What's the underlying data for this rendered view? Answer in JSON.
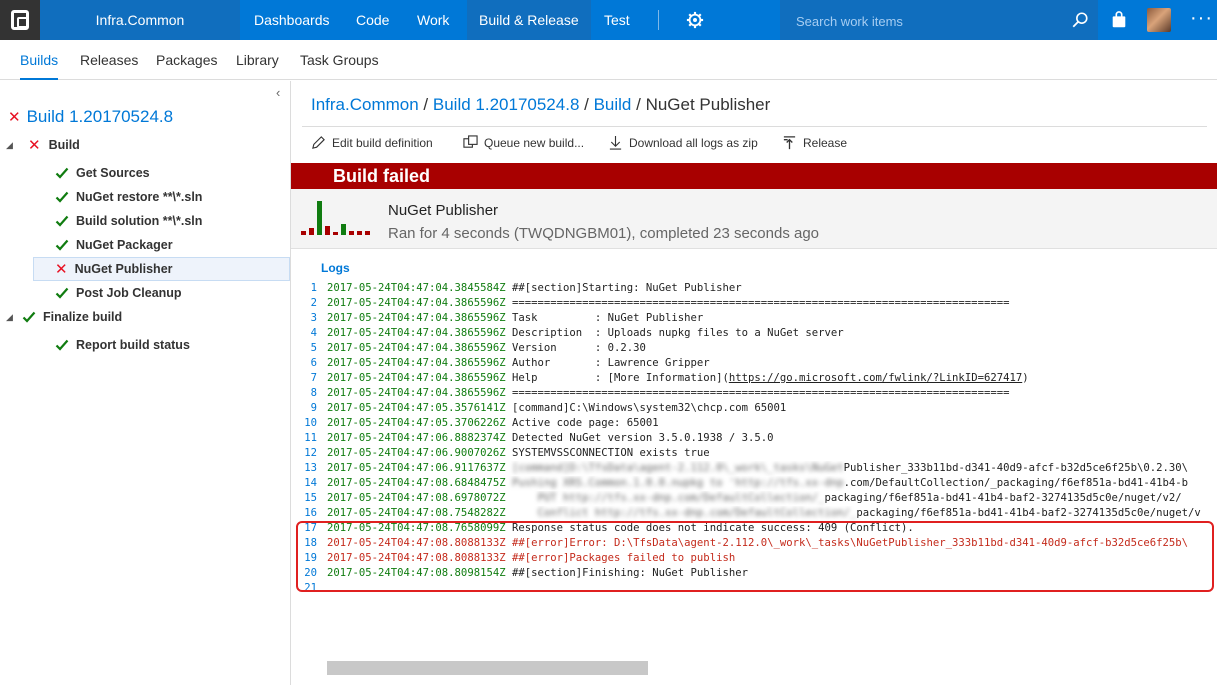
{
  "topbar": {
    "project": "Infra.Common",
    "nav": [
      "Dashboards",
      "Code",
      "Work",
      "Build & Release",
      "Test"
    ],
    "active_nav": "Build & Release",
    "search_placeholder": "Search work items",
    "more": "···"
  },
  "subnav": {
    "items": [
      "Builds",
      "Releases",
      "Packages",
      "Library",
      "Task Groups"
    ],
    "active": "Builds"
  },
  "left": {
    "collapse": "‹",
    "build_title": "Build 1.20170524.8",
    "tree": [
      {
        "label": "Build",
        "status": "failed",
        "level": 0
      },
      {
        "label": "Get Sources",
        "status": "succeeded",
        "level": 1
      },
      {
        "label": "NuGet restore **\\*.sln",
        "status": "succeeded",
        "level": 1
      },
      {
        "label": "Build solution **\\*.sln",
        "status": "succeeded",
        "level": 1
      },
      {
        "label": "NuGet Packager",
        "status": "succeeded",
        "level": 1
      },
      {
        "label": "NuGet Publisher",
        "status": "failed",
        "level": 1,
        "selected": true
      },
      {
        "label": "Post Job Cleanup",
        "status": "succeeded",
        "level": 1
      },
      {
        "label": "Finalize build",
        "status": "succeeded",
        "level": 0
      },
      {
        "label": "Report build status",
        "status": "succeeded",
        "level": 1
      }
    ]
  },
  "breadcrumb": {
    "project": "Infra.Common",
    "build": "Build 1.20170524.8",
    "section": "Build",
    "current": "NuGet Publisher",
    "sep": " / "
  },
  "toolbar": {
    "edit": "Edit build definition",
    "queue": "Queue new build...",
    "download": "Download all logs as zip",
    "release": "Release"
  },
  "status_banner": "Build failed",
  "summary": {
    "title": "NuGet Publisher",
    "subtitle": "Ran for 4 seconds (TWQDNGBM01), completed 23 seconds ago"
  },
  "logs_label": "Logs",
  "log_lines": [
    {
      "n": "1",
      "ts": "2017-05-24T04:47:04.3845584Z",
      "text": " ##[section]Starting: NuGet Publisher",
      "type": "section"
    },
    {
      "n": "2",
      "ts": "2017-05-24T04:47:04.3865596Z",
      "text": " ==============================================================================",
      "type": "normal"
    },
    {
      "n": "3",
      "ts": "2017-05-24T04:47:04.3865596Z",
      "text": " Task         : NuGet Publisher",
      "type": "normal"
    },
    {
      "n": "4",
      "ts": "2017-05-24T04:47:04.3865596Z",
      "text": " Description  : Uploads nupkg files to a NuGet server",
      "type": "normal"
    },
    {
      "n": "5",
      "ts": "2017-05-24T04:47:04.3865596Z",
      "text": " Version      : 0.2.30",
      "type": "normal"
    },
    {
      "n": "6",
      "ts": "2017-05-24T04:47:04.3865596Z",
      "text": " Author       : Lawrence Gripper",
      "type": "normal"
    },
    {
      "n": "7",
      "ts": "2017-05-24T04:47:04.3865596Z",
      "text": " Help         : [More Information](",
      "link": "https://go.microsoft.com/fwlink/?LinkID=627417",
      "tail": ")",
      "type": "normal"
    },
    {
      "n": "8",
      "ts": "2017-05-24T04:47:04.3865596Z",
      "text": " ==============================================================================",
      "type": "normal"
    },
    {
      "n": "9",
      "ts": "2017-05-24T04:47:05.3576141Z",
      "text": " [command]C:\\Windows\\system32\\chcp.com 65001",
      "type": "normal"
    },
    {
      "n": "10",
      "ts": "2017-05-24T04:47:05.3706226Z",
      "text": " Active code page: 65001",
      "type": "normal"
    },
    {
      "n": "11",
      "ts": "2017-05-24T04:47:06.8882374Z",
      "text": " Detected NuGet version 3.5.0.1938 / 3.5.0",
      "type": "normal"
    },
    {
      "n": "12",
      "ts": "2017-05-24T04:47:06.9007026Z",
      "text": " SYSTEMVSSCONNECTION exists true",
      "type": "normal"
    },
    {
      "n": "13",
      "ts": "2017-05-24T04:47:06.9117637Z",
      "blurred": " [command]D:\\TfsData\\agent-2.112.0\\_work\\_tasks\\NuGet",
      "text": "Publisher_333b11bd-d341-40d9-afcf-b32d5ce6f25b\\0.2.30\\",
      "type": "normal"
    },
    {
      "n": "14",
      "ts": "2017-05-24T04:47:08.6848475Z",
      "blurred": " Pushing XRS.Common.1.0.0.nupkg to 'http://tfs.xx-dnp",
      "text": ".com/DefaultCollection/_packaging/f6ef851a-bd41-41b4-b",
      "type": "normal"
    },
    {
      "n": "15",
      "ts": "2017-05-24T04:47:08.6978072Z",
      "blurred": "     PUT http://tfs.xx-dnp.com/DefaultCollection/_",
      "text": "packaging/f6ef851a-bd41-41b4-baf2-3274135d5c0e/nuget/v2/",
      "type": "normal"
    },
    {
      "n": "16",
      "ts": "2017-05-24T04:47:08.7548282Z",
      "blurred": "     Conflict http://tfs.xx-dnp.com/DefaultCollection/_",
      "text": "packaging/f6ef851a-bd41-41b4-baf2-3274135d5c0e/nuget/v",
      "type": "normal"
    },
    {
      "n": "17",
      "ts": "2017-05-24T04:47:08.7658099Z",
      "text": " Response status code does not indicate success: 409 (Conflict).",
      "type": "normal"
    },
    {
      "n": "18",
      "ts": "2017-05-24T04:47:08.8088133Z",
      "text": " ##[error]Error: D:\\TfsData\\agent-2.112.0\\_work\\_tasks\\NuGetPublisher_333b11bd-d341-40d9-afcf-b32d5ce6f25b\\",
      "type": "error"
    },
    {
      "n": "19",
      "ts": "2017-05-24T04:47:08.8088133Z",
      "text": " ##[error]Packages failed to publish",
      "type": "error"
    },
    {
      "n": "20",
      "ts": "2017-05-24T04:47:08.8098154Z",
      "text": " ##[section]Finishing: NuGet Publisher",
      "type": "section"
    },
    {
      "n": "21",
      "ts": "",
      "text": "",
      "type": "normal"
    }
  ],
  "colors": {
    "brand": "#0078d7",
    "failed": "#a80000",
    "error_text": "#c42b1c",
    "success": "#107c10"
  }
}
